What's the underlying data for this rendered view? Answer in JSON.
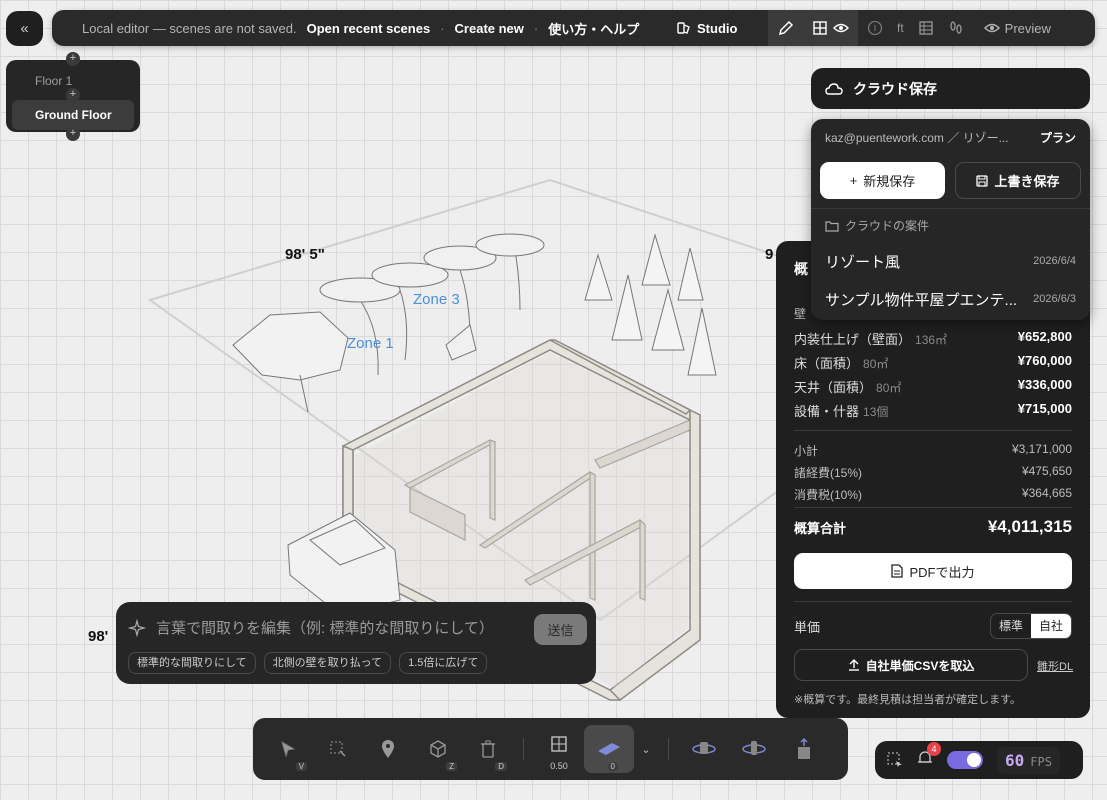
{
  "topbar": {
    "status": "Local editor — scenes are not saved.",
    "open_recent": "Open recent scenes",
    "create_new": "Create new",
    "help": "使い方・ヘルプ",
    "studio": "Studio",
    "unit": "ft",
    "preview": "Preview"
  },
  "floors": [
    "Floor 1",
    "Ground Floor"
  ],
  "cloud": {
    "title": "クラウド保存",
    "user": "kaz@puentework.com ／ リゾー...",
    "plan": "プラン",
    "new_save": "新規保存",
    "overwrite": "上書き保存",
    "section": "クラウドの案件",
    "projects": [
      {
        "name": "リゾート風",
        "date": "2026/6/4"
      },
      {
        "name": "サンプル物件平屋プエンテ...",
        "date": "2026/6/3"
      }
    ]
  },
  "estimate": {
    "title": "概",
    "wall": "壁",
    "rows": [
      {
        "label": "内装仕上げ（壁面）",
        "qty": "136㎡",
        "value": "¥652,800"
      },
      {
        "label": "床（面積）",
        "qty": "80㎡",
        "value": "¥760,000"
      },
      {
        "label": "天井（面積）",
        "qty": "80㎡",
        "value": "¥336,000"
      },
      {
        "label": "設備・什器",
        "qty": "13個",
        "value": "¥715,000"
      }
    ],
    "subtotal_label": "小計",
    "subtotal": "¥3,171,000",
    "overhead_label": "諸経費(15%)",
    "overhead": "¥475,650",
    "tax_label": "消費税(10%)",
    "tax": "¥364,665",
    "total_label": "概算合計",
    "total": "¥4,011,315",
    "pdf": "PDFで出力",
    "unit_label": "単価",
    "unit_options": [
      "標準",
      "自社"
    ],
    "csv": "自社単価CSVを取込",
    "template": "雛形DL",
    "note": "※概算です。最終見積は担当者が確定します。"
  },
  "prompt": {
    "placeholder": "言葉で間取りを編集（例: 標準的な間取りにして）",
    "send": "送信",
    "chips": [
      "標準的な間取りにして",
      "北側の壁を取り払って",
      "1.5倍に広げて"
    ]
  },
  "toolbar": {
    "keys": [
      "V",
      "Z",
      "D"
    ],
    "grid_value": "0.50",
    "floor_badge": "0"
  },
  "status": {
    "notifications": "4",
    "fps": "60",
    "fps_label": "FPS"
  },
  "scene": {
    "dims": [
      "98' 5\"",
      "98'",
      "9"
    ],
    "zones": [
      "Zone 3",
      "Zone 1"
    ]
  }
}
